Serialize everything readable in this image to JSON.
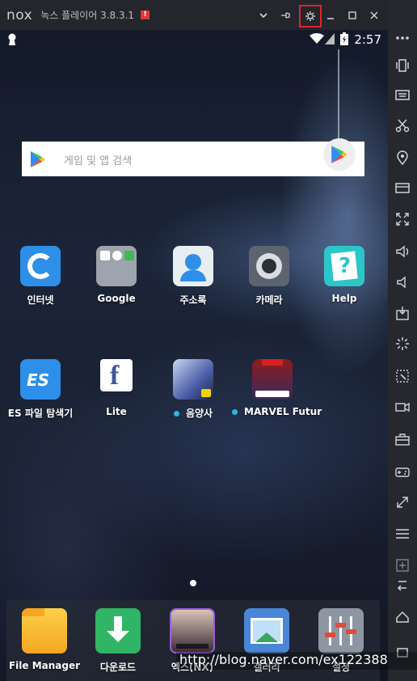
{
  "window": {
    "logo": "nox",
    "title": "녹스 플레이어 3.8.3.1",
    "alert_badge": "!",
    "buttons": {
      "collapse_icon": "chevron-down-icon",
      "pin_icon": "pin-icon",
      "settings_icon": "gear-icon",
      "minimize_icon": "minimize-icon",
      "maximize_icon": "maximize-icon",
      "close_icon": "close-icon"
    },
    "settings_highlight_color": "#e1232a"
  },
  "statusbar": {
    "time": "2:57"
  },
  "search": {
    "placeholder": "게임 및 앱 검색"
  },
  "home_apps_row1": [
    {
      "label": "인터넷"
    },
    {
      "label": "Google"
    },
    {
      "label": "주소록"
    },
    {
      "label": "카메라"
    },
    {
      "label": "Help"
    }
  ],
  "home_apps_row2": [
    {
      "label": "ES 파일 탐색기"
    },
    {
      "label": "Lite"
    },
    {
      "label": "음양사"
    },
    {
      "label": "MARVEL Futur"
    }
  ],
  "dock_apps": [
    {
      "label": "File Manager"
    },
    {
      "label": "다운로드"
    },
    {
      "label": "엑스(NX)"
    },
    {
      "label": "갤러리"
    },
    {
      "label": "설정"
    }
  ],
  "sidebar_icons": [
    "more-icon",
    "shake-icon",
    "keyboard-icon",
    "screenshot-cut-icon",
    "location-icon",
    "display-icon",
    "fullscreen-icon",
    "volume-up-icon",
    "volume-down-icon",
    "apk-install-icon",
    "loading-icon",
    "virtual-location-icon",
    "video-record-icon",
    "toolbox-icon",
    "gamepad-icon",
    "resize-icon",
    "menu-icon",
    "multi-instance-icon",
    "back-icon",
    "home-icon",
    "recent-apps-icon"
  ],
  "watermark": "http://blog.naver.com/ex122388",
  "colors": {
    "titlebar": "#24262c",
    "sidebar": "#26282e",
    "accent_dot": "#2ab8e6"
  }
}
